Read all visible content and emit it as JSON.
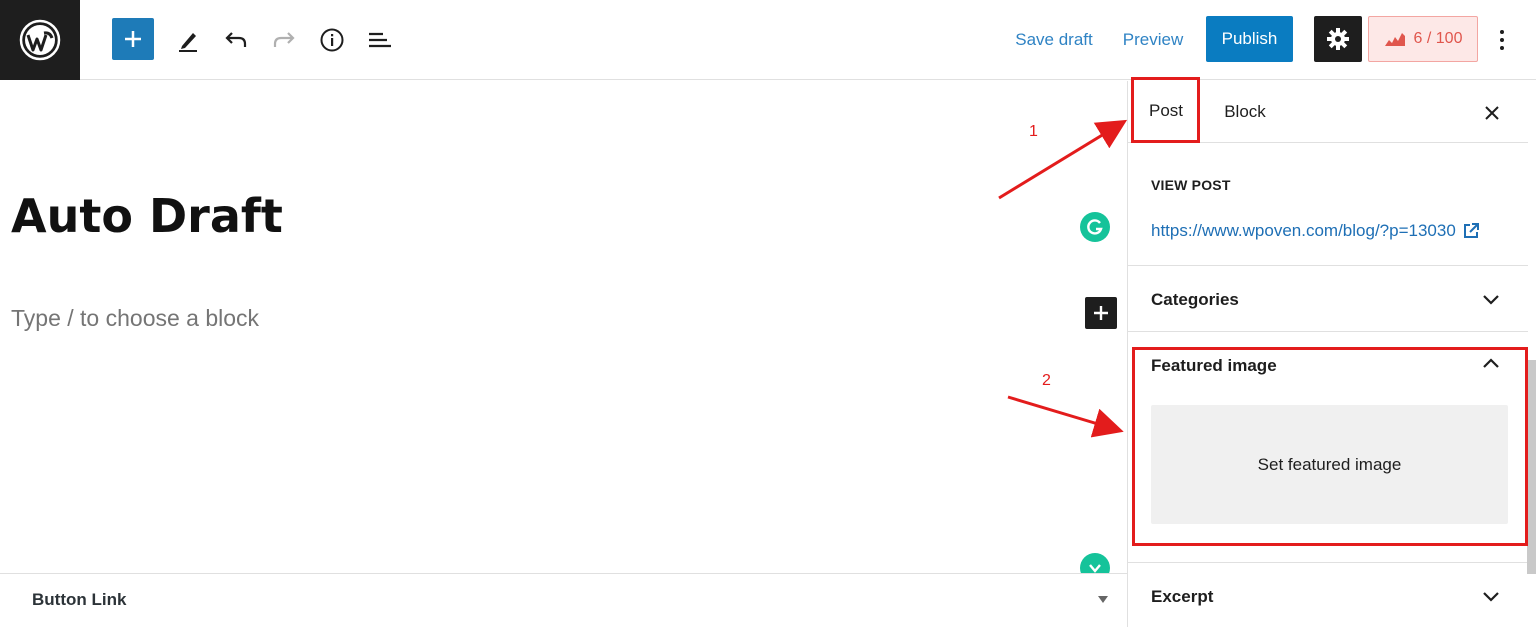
{
  "toolbar": {
    "save_draft_label": "Save draft",
    "preview_label": "Preview",
    "publish_label": "Publish",
    "score_label": "6 / 100",
    "icons": [
      "wordpress-logo-icon",
      "plus-icon",
      "pencil-icon",
      "undo-icon",
      "redo-icon",
      "info-icon",
      "list-view-icon",
      "gear-icon",
      "seo-score-icon",
      "more-vertical-icon"
    ]
  },
  "editor": {
    "title": "Auto Draft",
    "placeholder": "Type / to choose a block",
    "meta_box_label": "Button Link"
  },
  "annotations": {
    "step1": "1",
    "step2": "2"
  },
  "sidebar": {
    "tabs": [
      {
        "label": "Post"
      },
      {
        "label": "Block"
      }
    ],
    "view_post": {
      "label": "VIEW POST",
      "url": "https://www.wpoven.com/blog/?p=13030"
    },
    "panels": {
      "categories": "Categories",
      "featured_image": "Featured image",
      "set_featured_image": "Set featured image",
      "excerpt": "Excerpt"
    }
  },
  "colors": {
    "accent": "#0a7cc1",
    "annotation_red": "#e31c1c",
    "grammarly_green": "#15c39a"
  }
}
